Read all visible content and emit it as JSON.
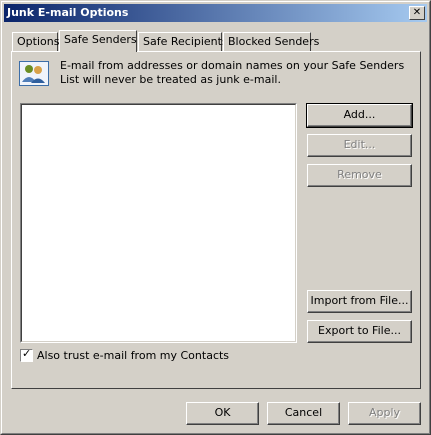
{
  "window": {
    "title": "Junk E-mail Options"
  },
  "tabs": [
    {
      "label": "Options",
      "active": false
    },
    {
      "label": "Safe Senders",
      "active": true
    },
    {
      "label": "Safe Recipients",
      "active": false
    },
    {
      "label": "Blocked Senders",
      "active": false
    }
  ],
  "info": {
    "icon": "safe-senders-people-icon",
    "text": "E-mail from addresses or domain names on your Safe Senders List will never be treated as junk e-mail."
  },
  "list": {
    "items": []
  },
  "side_buttons": {
    "add": "Add...",
    "edit": "Edit...",
    "remove": "Remove",
    "import": "Import from File...",
    "export": "Export to File..."
  },
  "checkbox": {
    "label": "Also trust e-mail from my Contacts",
    "checked": true
  },
  "footer": {
    "ok": "OK",
    "cancel": "Cancel",
    "apply": "Apply"
  }
}
